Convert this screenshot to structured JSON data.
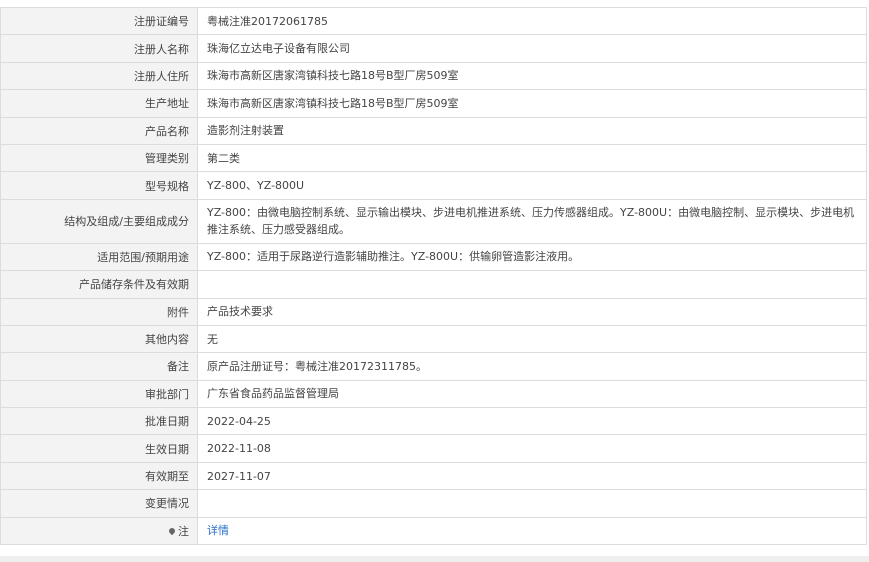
{
  "rows": [
    {
      "label": "注册证编号",
      "value": "粤械注准20172061785"
    },
    {
      "label": "注册人名称",
      "value": "珠海亿立达电子设备有限公司"
    },
    {
      "label": "注册人住所",
      "value": "珠海市高新区唐家湾镇科技七路18号B型厂房509室"
    },
    {
      "label": "生产地址",
      "value": "珠海市高新区唐家湾镇科技七路18号B型厂房509室"
    },
    {
      "label": "产品名称",
      "value": "造影剂注射装置"
    },
    {
      "label": "管理类别",
      "value": "第二类"
    },
    {
      "label": "型号规格",
      "value": "YZ-800、YZ-800U"
    },
    {
      "label": "结构及组成/主要组成成分",
      "value": "YZ-800：由微电脑控制系统、显示输出模块、步进电机推进系统、压力传感器组成。YZ-800U：由微电脑控制、显示模块、步进电机推注系统、压力感受器组成。"
    },
    {
      "label": "适用范围/预期用途",
      "value": "YZ-800：适用于尿路逆行造影辅助推注。YZ-800U：供输卵管造影注液用。"
    },
    {
      "label": "产品储存条件及有效期",
      "value": ""
    },
    {
      "label": "附件",
      "value": "产品技术要求"
    },
    {
      "label": "其他内容",
      "value": "无"
    },
    {
      "label": "备注",
      "value": "原产品注册证号：粤械注准20172311785。"
    },
    {
      "label": "审批部门",
      "value": "广东省食品药品监督管理局"
    },
    {
      "label": "批准日期",
      "value": "2022-04-25"
    },
    {
      "label": "生效日期",
      "value": "2022-11-08"
    },
    {
      "label": "有效期至",
      "value": "2027-11-07"
    },
    {
      "label": "变更情况",
      "value": ""
    }
  ],
  "note": {
    "label": "注",
    "link": "详情",
    "icon": "location-pin-icon"
  }
}
